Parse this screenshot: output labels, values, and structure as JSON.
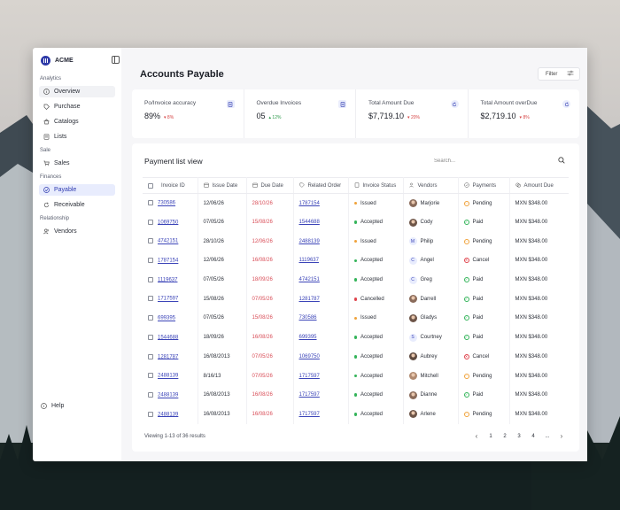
{
  "app": {
    "brand": "ACME"
  },
  "sidebar": {
    "sections": [
      {
        "title": "Analytics",
        "items": [
          {
            "label": "Overview",
            "icon": "info-icon"
          },
          {
            "label": "Purchase",
            "icon": "tag-icon"
          },
          {
            "label": "Catalogs",
            "icon": "basket-icon"
          },
          {
            "label": "Lists",
            "icon": "list-icon"
          }
        ]
      },
      {
        "title": "Sale",
        "items": [
          {
            "label": "Sales",
            "icon": "cart-icon"
          }
        ]
      },
      {
        "title": "Finances",
        "items": [
          {
            "label": "Payable",
            "icon": "payable-icon"
          },
          {
            "label": "Receivable",
            "icon": "refresh-icon"
          }
        ]
      },
      {
        "title": "Relationship",
        "items": [
          {
            "label": "Vendors",
            "icon": "users-icon"
          }
        ]
      }
    ],
    "help": "Help"
  },
  "header": {
    "title": "Accounts Payable",
    "filter": "Filter"
  },
  "kpis": [
    {
      "label": "Po/Invoice accuracy",
      "value": "89%",
      "delta": "8%",
      "direction": "down"
    },
    {
      "label": "Overdue Invoices",
      "value": "05",
      "delta": "12%",
      "direction": "up"
    },
    {
      "label": "Total Amount Due",
      "value": "$7,719.10",
      "delta": "20%",
      "direction": "down"
    },
    {
      "label": "Total Amount overDue",
      "value": "$2,719.10",
      "delta": "8%",
      "direction": "down"
    }
  ],
  "table": {
    "title": "Payment list view",
    "search_placeholder": "Search...",
    "columns": [
      "Invoice ID",
      "Issue Date",
      "Due Date",
      "Related Order",
      "Invoice Status",
      "Vendors",
      "Payments",
      "Amount Due"
    ],
    "rows": [
      {
        "id": "730586",
        "issue": "12/06/26",
        "due": "28/10/26",
        "order": "1787154",
        "status": "Issued",
        "vendor": "Marjorie",
        "avatar": "photo",
        "payment": "Pending",
        "amount": "MXN $348.00"
      },
      {
        "id": "1069750",
        "issue": "07/05/26",
        "due": "15/08/26",
        "order": "1544688",
        "status": "Accepted",
        "vendor": "Cody",
        "avatar": "photo",
        "payment": "Paid",
        "amount": "MXN $348.00"
      },
      {
        "id": "4742151",
        "issue": "28/10/26",
        "due": "12/06/26",
        "order": "2488139",
        "status": "Issued",
        "vendor": "Philip",
        "avatar": "M",
        "payment": "Pending",
        "amount": "MXN $348.00"
      },
      {
        "id": "1787154",
        "issue": "12/06/26",
        "due": "16/08/26",
        "order": "1119637",
        "status": "Accepted",
        "vendor": "Angel",
        "avatar": "C",
        "payment": "Cancel",
        "amount": "MXN $348.00"
      },
      {
        "id": "1119637",
        "issue": "07/05/26",
        "due": "18/09/26",
        "order": "4742151",
        "status": "Accepted",
        "vendor": "Greg",
        "avatar": "C",
        "payment": "Paid",
        "amount": "MXN $348.00"
      },
      {
        "id": "1717597",
        "issue": "15/08/26",
        "due": "07/05/26",
        "order": "1281787",
        "status": "Cancelled",
        "vendor": "Darrell",
        "avatar": "photo",
        "payment": "Paid",
        "amount": "MXN $348.00"
      },
      {
        "id": "699395",
        "issue": "07/05/26",
        "due": "15/08/26",
        "order": "730586",
        "status": "Issued",
        "vendor": "Gladys",
        "avatar": "photo",
        "payment": "Paid",
        "amount": "MXN $348.00"
      },
      {
        "id": "1544688",
        "issue": "18/09/26",
        "due": "16/08/26",
        "order": "699395",
        "status": "Accepted",
        "vendor": "Courtney",
        "avatar": "S",
        "payment": "Paid",
        "amount": "MXN $348.00"
      },
      {
        "id": "1281787",
        "issue": "16/08/2013",
        "due": "07/05/26",
        "order": "1069750",
        "status": "Accepted",
        "vendor": "Aubrey",
        "avatar": "photo",
        "payment": "Cancel",
        "amount": "MXN $348.00"
      },
      {
        "id": "2488139",
        "issue": "8/16/13",
        "due": "07/05/26",
        "order": "1717597",
        "status": "Accepted",
        "vendor": "Mitchell",
        "avatar": "photo",
        "payment": "Pending",
        "amount": "MXN $348.00"
      },
      {
        "id": "2488139",
        "issue": "16/08/2013",
        "due": "16/08/26",
        "order": "1717597",
        "status": "Accepted",
        "vendor": "Dianne",
        "avatar": "photo",
        "payment": "Paid",
        "amount": "MXN $348.00"
      },
      {
        "id": "2488139",
        "issue": "16/08/2013",
        "due": "16/08/26",
        "order": "1717597",
        "status": "Accepted",
        "vendor": "Arlene",
        "avatar": "photo",
        "payment": "Pending",
        "amount": "MXN $348.00"
      }
    ],
    "footer": "Viewing 1-13 of 36 results",
    "pages": [
      "1",
      "2",
      "3",
      "4",
      "..."
    ]
  },
  "colors": {
    "accent": "#2f3bb0",
    "due": "#d94e58",
    "issued": "#f0a23a",
    "accepted": "#34b45a",
    "cancelled": "#e0454d",
    "pending": "#f0a23a",
    "paid": "#34b45a",
    "cancel": "#e0454d"
  }
}
